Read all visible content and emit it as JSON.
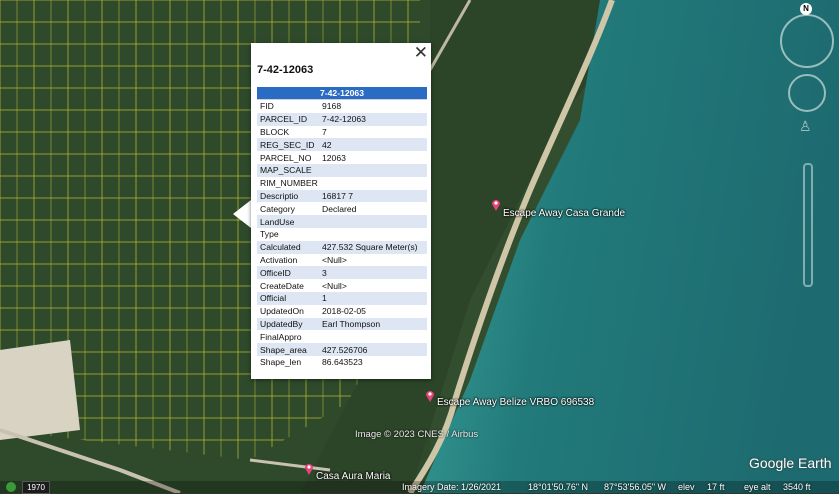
{
  "popup": {
    "title": "7-42-12063",
    "table_header": "7-42-12063",
    "close_symbol": "✕",
    "rows": [
      {
        "key": "FID",
        "value": "9168"
      },
      {
        "key": "PARCEL_ID",
        "value": "7-42-12063"
      },
      {
        "key": "BLOCK",
        "value": "7"
      },
      {
        "key": "REG_SEC_ID",
        "value": "42"
      },
      {
        "key": "PARCEL_NO",
        "value": "12063"
      },
      {
        "key": "MAP_SCALE",
        "value": ""
      },
      {
        "key": "RIM_NUMBER",
        "value": ""
      },
      {
        "key": "Descriptio",
        "value": "16817 7"
      },
      {
        "key": "Category",
        "value": "Declared"
      },
      {
        "key": "LandUse",
        "value": ""
      },
      {
        "key": "Type",
        "value": ""
      },
      {
        "key": "Calculated",
        "value": "427.532 Square Meter(s)"
      },
      {
        "key": "Activation",
        "value": "<Null>"
      },
      {
        "key": "OfficeID",
        "value": "3"
      },
      {
        "key": "CreateDate",
        "value": "<Null>"
      },
      {
        "key": "Official",
        "value": "1"
      },
      {
        "key": "UpdatedOn",
        "value": "2018-02-05"
      },
      {
        "key": "UpdatedBy",
        "value": "Earl Thompson"
      },
      {
        "key": "FinalAppro",
        "value": ""
      },
      {
        "key": "Shape_area",
        "value": "427.526706"
      },
      {
        "key": "Shape_len",
        "value": "86.643523"
      }
    ]
  },
  "places": {
    "casa_grande": "Escape Away Casa Grande",
    "vrbo": "Escape Away Belize VRBO 696538",
    "casa_aura": "Casa Aura Maria"
  },
  "map": {
    "attribution": "Image © 2023 CNES / Airbus",
    "logo": "Google Earth",
    "compass_letter": "N",
    "historical_year": "1970"
  },
  "status": {
    "imagery_date": "Imagery Date: 1/26/2021",
    "lat": "18°01'50.76\" N",
    "lon": "87°53'56.05\" W",
    "elev_label": "elev",
    "elev_value": "17 ft",
    "eye_alt_label": "eye alt",
    "eye_alt_value": "3540 ft"
  },
  "colors": {
    "land": "#2f4a2c",
    "sea": "#2e8a86",
    "parcel_lines": "#e8e23a",
    "header_blue": "#2a6cc4",
    "alt_row": "#dde6f2"
  }
}
